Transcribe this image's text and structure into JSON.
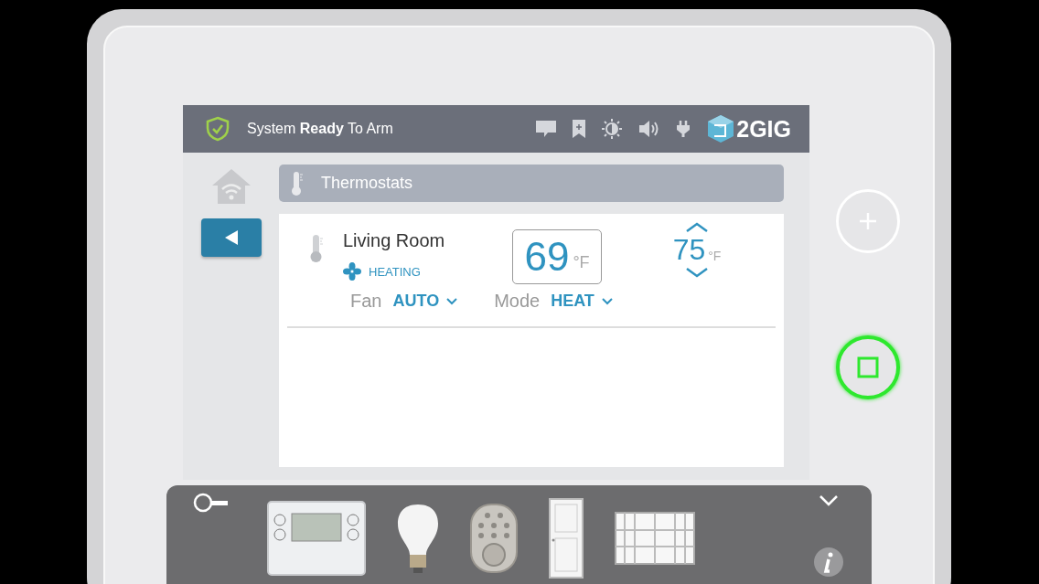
{
  "status_bar": {
    "message": "System **Ready** To Arm",
    "logo": "2GIG"
  },
  "section": {
    "title": "Thermostats"
  },
  "thermostats": [
    {
      "name": "Living Room",
      "status": "HEATING",
      "current": "69",
      "current_unit": "°F",
      "setpoint": "75",
      "setpoint_unit": "°F",
      "fan_label": "Fan",
      "fan_value": "AUTO",
      "mode_label": "Mode",
      "mode_value": "HEAT"
    }
  ],
  "tray": {
    "items": [
      {
        "kind": "thermostat"
      },
      {
        "kind": "bulb"
      },
      {
        "kind": "deadbolt"
      },
      {
        "kind": "door"
      },
      {
        "kind": "window"
      }
    ]
  }
}
